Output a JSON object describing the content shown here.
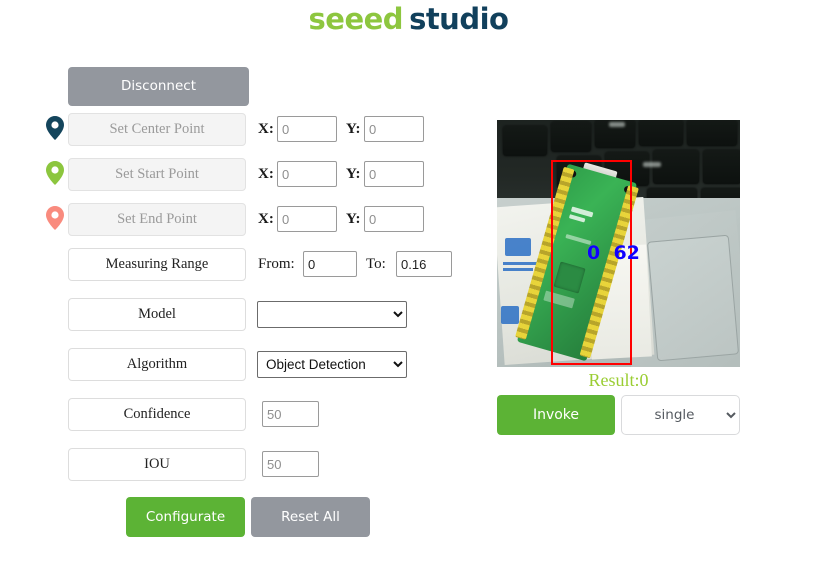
{
  "brand": {
    "part1": "seeed",
    "part2": "studio",
    "green": "#8DC63F",
    "navy": "#11405C"
  },
  "connection": {
    "button_label": "Disconnect",
    "color": "#93979E"
  },
  "points": [
    {
      "icon": "location-pin-icon",
      "pin_color": "#14455C",
      "button_label": "Set Center Point",
      "x_label": "X:",
      "y_label": "Y:",
      "x_placeholder": "0",
      "y_placeholder": "0",
      "x_value": "",
      "y_value": ""
    },
    {
      "icon": "location-pin-icon",
      "pin_color": "#8CC63E",
      "button_label": "Set Start Point",
      "x_label": "X:",
      "y_label": "Y:",
      "x_placeholder": "0",
      "y_placeholder": "0",
      "x_value": "",
      "y_value": ""
    },
    {
      "icon": "location-pin-icon",
      "pin_color": "#F98B7E",
      "button_label": "Set End Point",
      "x_label": "X:",
      "y_label": "Y:",
      "x_placeholder": "0",
      "y_placeholder": "0",
      "x_value": "",
      "y_value": ""
    }
  ],
  "measuring_range": {
    "label": "Measuring Range",
    "from_label": "From:",
    "to_label": "To:",
    "from_value": "0",
    "to_value": "0.16"
  },
  "model": {
    "label": "Model",
    "selected": "",
    "options": [
      ""
    ]
  },
  "algorithm": {
    "label": "Algorithm",
    "selected": "Object Detection",
    "options": [
      "Object Detection"
    ]
  },
  "confidence": {
    "label": "Confidence",
    "placeholder": "50",
    "value": ""
  },
  "iou": {
    "label": "IOU",
    "placeholder": "50",
    "value": ""
  },
  "actions": {
    "configurate_label": "Configurate",
    "configurate_color": "#5CB335",
    "reset_label": "Reset All",
    "reset_color": "#93979E"
  },
  "preview": {
    "detection_label": "0  62",
    "detection_box_color": "#FF0000",
    "detection_text_color": "#1000FF",
    "scene_description": "green-pcb-on-laptop"
  },
  "result": {
    "text": "Result:0",
    "color": "#9ACD32"
  },
  "invoke": {
    "label": "Invoke",
    "color": "#5CB335"
  },
  "mode": {
    "selected": "single",
    "options": [
      "single"
    ]
  }
}
